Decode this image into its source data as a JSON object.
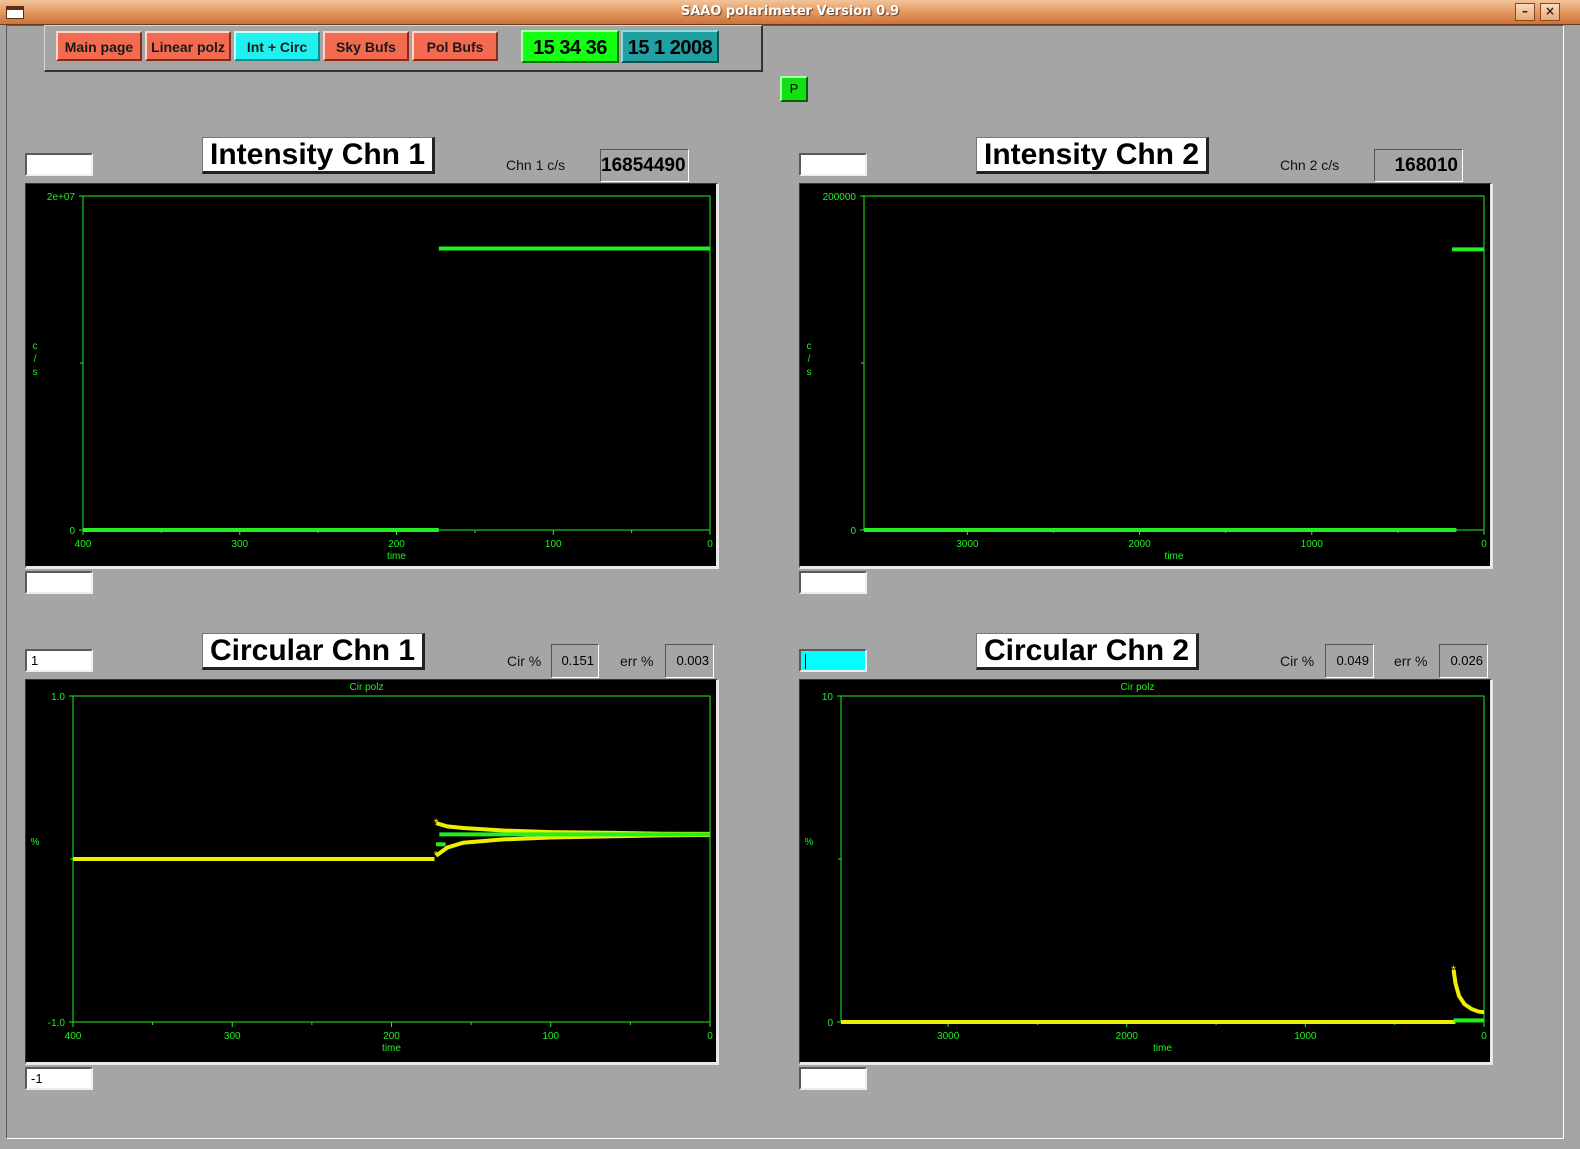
{
  "window": {
    "title": "SAAO polarimeter Version 0.9",
    "minimize_glyph": "–",
    "close_glyph": "×"
  },
  "nav": [
    {
      "label": "Main page",
      "active": false
    },
    {
      "label": "Linear polz",
      "active": false
    },
    {
      "label": "Int + Circ",
      "active": true
    },
    {
      "label": "Sky Bufs",
      "active": false
    },
    {
      "label": "Pol Bufs",
      "active": false
    }
  ],
  "clock": {
    "time": "15 34 36",
    "date": "15 1 2008",
    "time_color": "#14ff14",
    "date_color": "#20a0a0"
  },
  "p_button": {
    "label": "P"
  },
  "panels": {
    "int1": {
      "heading": "Intensity Chn 1",
      "stat_label": "Chn 1 c/s",
      "stat_value": "16854490",
      "input_top": "",
      "input_bottom": ""
    },
    "int2": {
      "heading": "Intensity Chn 2",
      "stat_label": "Chn 2 c/s",
      "stat_value": "168010",
      "input_top": "",
      "input_bottom": ""
    },
    "circ1": {
      "heading": "Circular Chn 1",
      "cir_label": "Cir %",
      "cir_value": "0.151",
      "err_label": "err %",
      "err_value": "0.003",
      "input_top": "1",
      "input_bottom": "-1"
    },
    "circ2": {
      "heading": "Circular Chn 2",
      "cir_label": "Cir %",
      "cir_value": "0.049",
      "err_label": "err %",
      "err_value": "0.026",
      "input_top": "",
      "input_bottom": ""
    }
  },
  "chart_data": [
    {
      "id": "int1",
      "type": "line",
      "title": "",
      "xlabel": "time",
      "ylabel": "c/s",
      "xlim": [
        400,
        0
      ],
      "ylim": [
        0,
        20000000
      ],
      "x_ticks": [
        "400",
        "300",
        "200",
        "100",
        "0"
      ],
      "y_ticks": [
        "2e+07",
        "0"
      ],
      "series": [
        {
          "color": "#22ee22",
          "points": [
            [
              400,
              0
            ],
            [
              173,
              0
            ]
          ]
        },
        {
          "color": "#22ee22",
          "points": [
            [
              173,
              16854490
            ],
            [
              0,
              16854490
            ]
          ]
        }
      ]
    },
    {
      "id": "int2",
      "type": "line",
      "title": "",
      "xlabel": "time",
      "ylabel": "c/s",
      "xlim": [
        3600,
        0
      ],
      "ylim": [
        0,
        200000
      ],
      "x_ticks": [
        "3000",
        "2000",
        "1000",
        "0"
      ],
      "y_ticks": [
        "200000",
        "0"
      ],
      "series": [
        {
          "color": "#22ee22",
          "points": [
            [
              3600,
              0
            ],
            [
              160,
              0
            ]
          ]
        },
        {
          "color": "#22ee22",
          "points": [
            [
              185,
              168010
            ],
            [
              0,
              168010
            ]
          ]
        }
      ]
    },
    {
      "id": "circ1",
      "type": "line",
      "title": "Cir polz",
      "xlabel": "time",
      "ylabel": "%",
      "xlim": [
        400,
        0
      ],
      "ylim": [
        -1.0,
        1.0
      ],
      "x_ticks": [
        "400",
        "300",
        "200",
        "100",
        "0"
      ],
      "y_ticks": [
        "1.0",
        "-1.0"
      ],
      "series": [
        {
          "color": "#eeee00",
          "points": [
            [
              400,
              0
            ],
            [
              173,
              0
            ]
          ]
        },
        {
          "color": "#eeee00",
          "points": [
            [
              172,
              0.22
            ],
            [
              165,
              0.2
            ],
            [
              155,
              0.19
            ],
            [
              130,
              0.175
            ],
            [
              100,
              0.165
            ],
            [
              60,
              0.16
            ],
            [
              30,
              0.155
            ],
            [
              0,
              0.154
            ]
          ]
        },
        {
          "color": "#eeee00",
          "points": [
            [
              172,
              0.02
            ],
            [
              165,
              0.07
            ],
            [
              155,
              0.1
            ],
            [
              130,
              0.12
            ],
            [
              100,
              0.132
            ],
            [
              60,
              0.14
            ],
            [
              30,
              0.145
            ],
            [
              0,
              0.147
            ]
          ]
        },
        {
          "color": "#22ee22",
          "points": [
            [
              170,
              0.151
            ],
            [
              0,
              0.151
            ]
          ]
        },
        {
          "color": "#22ee22",
          "points": [
            [
              172,
              0.09
            ],
            [
              166,
              0.09
            ]
          ]
        }
      ]
    },
    {
      "id": "circ2",
      "type": "line",
      "title": "Cir polz",
      "xlabel": "time",
      "ylabel": "%",
      "xlim": [
        3600,
        0
      ],
      "ylim": [
        0,
        10
      ],
      "x_ticks": [
        "3000",
        "2000",
        "1000",
        "0"
      ],
      "y_ticks": [
        "10",
        "0"
      ],
      "series": [
        {
          "color": "#eeee00",
          "points": [
            [
              3600,
              0
            ],
            [
              160,
              0
            ]
          ]
        },
        {
          "color": "#eeee00",
          "points": [
            [
              170,
              1.6
            ],
            [
              160,
              1.2
            ],
            [
              140,
              0.8
            ],
            [
              110,
              0.55
            ],
            [
              70,
              0.4
            ],
            [
              30,
              0.32
            ],
            [
              0,
              0.3
            ]
          ]
        },
        {
          "color": "#22ee22",
          "points": [
            [
              170,
              0.05
            ],
            [
              0,
              0.05
            ]
          ]
        }
      ]
    }
  ]
}
